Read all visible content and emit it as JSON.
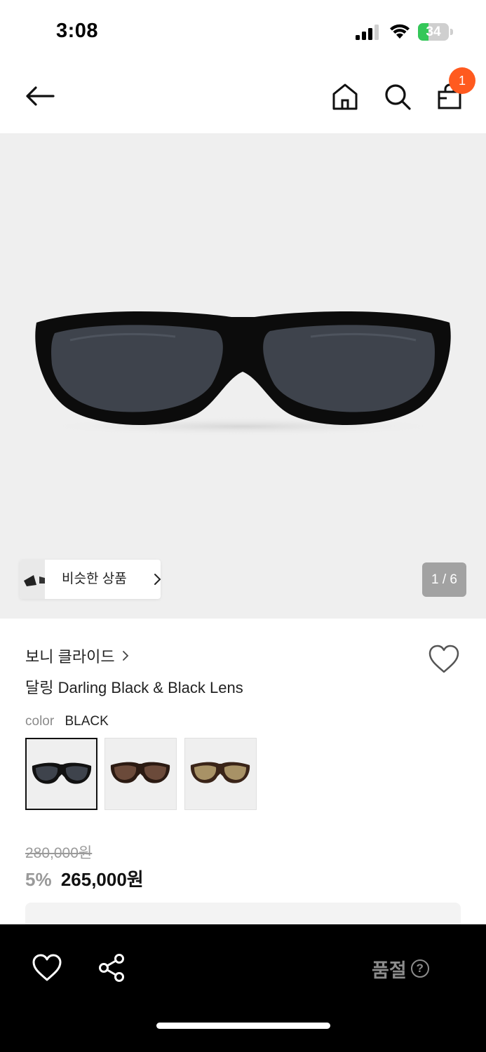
{
  "status_bar": {
    "time": "3:08",
    "battery_level": "34",
    "battery_fraction": 0.34,
    "colors": {
      "battery_fill": "#34c759"
    }
  },
  "header": {
    "back_icon": "arrow-left-icon",
    "home_icon": "home-icon",
    "search_icon": "search-icon",
    "cart_icon": "shopping-bag-icon",
    "cart_count": "1",
    "colors": {
      "badge": "#ff5a1f"
    }
  },
  "gallery": {
    "similar_label": "비슷한 상품",
    "pager": "1 / 6",
    "current_page": 1,
    "total_pages": 6
  },
  "product": {
    "brand": "보니 클라이드",
    "name": "달링 Darling Black & Black Lens",
    "color_key": "color",
    "color_value": "BLACK",
    "swatches": [
      {
        "name": "black",
        "lens_color": "#3e434c",
        "frame_color": "#111111",
        "selected": true
      },
      {
        "name": "brown",
        "lens_color": "#6b4a3a",
        "frame_color": "#2b1a12",
        "selected": false
      },
      {
        "name": "gold",
        "lens_color": "#a89266",
        "frame_color": "#3a2418",
        "selected": false
      }
    ],
    "original_price": "280,000원",
    "discount": "5%",
    "final_price": "265,000원"
  },
  "bottom_bar": {
    "wishlist_icon": "heart-icon",
    "share_icon": "share-icon",
    "soldout_label": "품절",
    "help_glyph": "?"
  }
}
